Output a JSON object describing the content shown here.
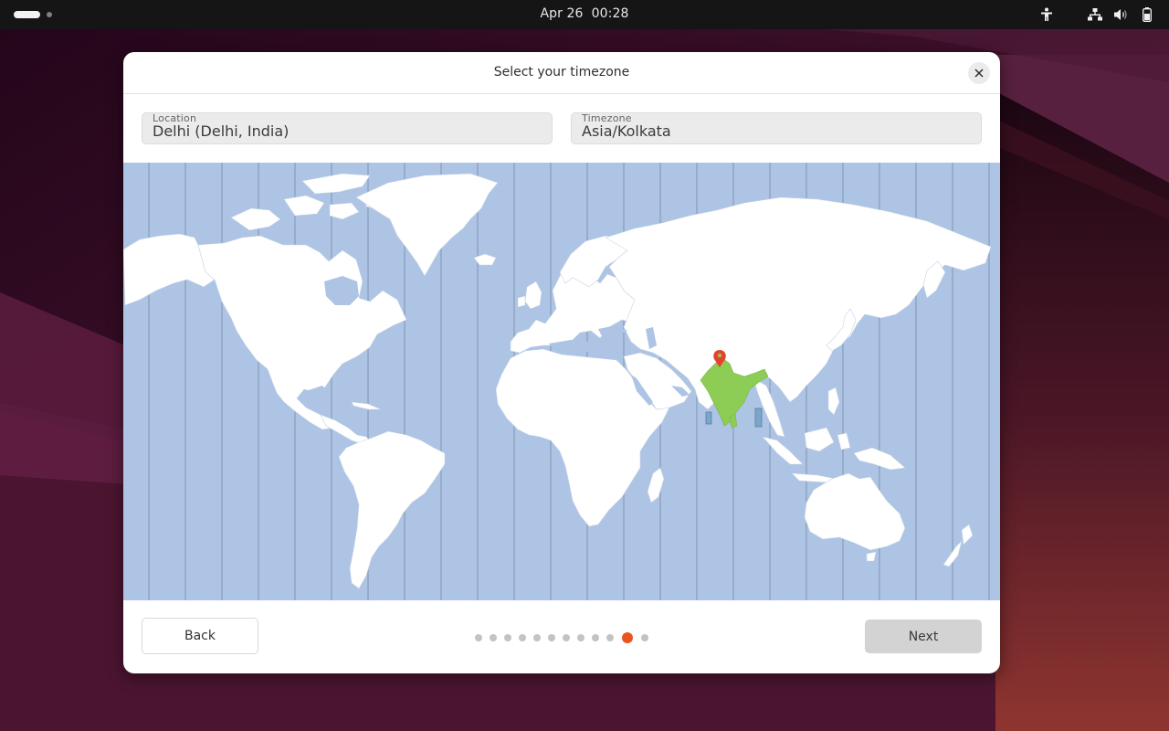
{
  "topbar": {
    "date": "Apr 26",
    "time": "00:28",
    "tray_icons": [
      "accessibility-icon",
      "network-wired-icon",
      "volume-icon",
      "battery-icon"
    ]
  },
  "dialog": {
    "title": "Select your timezone",
    "close_icon": "close-icon",
    "location": {
      "label": "Location",
      "value": "Delhi (Delhi, India)"
    },
    "timezone": {
      "label": "Timezone",
      "value": "Asia/Kolkata"
    },
    "map": {
      "selected_country": "India",
      "selected_city": "Delhi",
      "colors": {
        "ocean": "#adc4e5",
        "land": "#ffffff",
        "highlight": "#8dcc55",
        "pin": "#e8402f",
        "tz_line": "#7d8ea8"
      }
    },
    "footer": {
      "back_label": "Back",
      "next_label": "Next",
      "progress": {
        "total_steps": 12,
        "current_step": 11
      }
    }
  },
  "colors": {
    "accent": "#e95420"
  }
}
